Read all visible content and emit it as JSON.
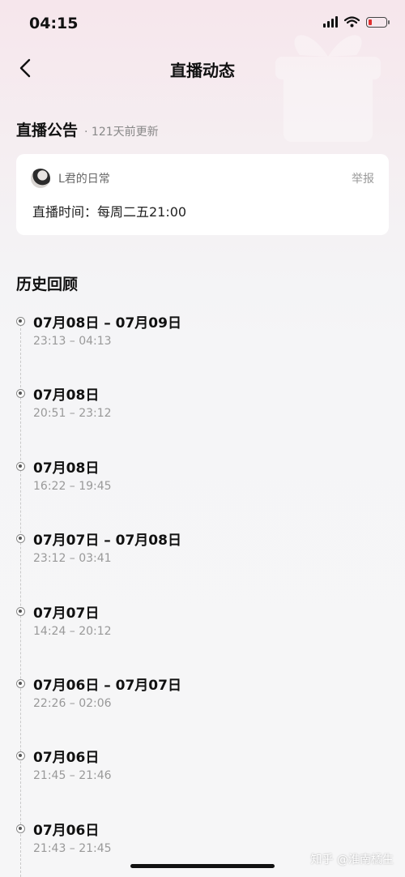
{
  "status_bar": {
    "time": "04:15",
    "icons": [
      "signal-icon",
      "wifi-icon",
      "battery-icon"
    ],
    "battery_level": 0.15,
    "battery_color": "#e0302f"
  },
  "nav": {
    "back_icon": "chevron-left-icon",
    "title": "直播动态"
  },
  "announcement": {
    "title": "直播公告",
    "updated": "· 121天前更新",
    "author": "L君的日常",
    "report_label": "举报",
    "content": "直播时间：每周二五21:00"
  },
  "history": {
    "title": "历史回顾",
    "entries": [
      {
        "date": "07月08日 – 07月09日",
        "time": "23:13 – 04:13"
      },
      {
        "date": "07月08日",
        "time": "20:51 – 23:12"
      },
      {
        "date": "07月08日",
        "time": "16:22 – 19:45"
      },
      {
        "date": "07月07日 – 07月08日",
        "time": "23:12 – 03:41"
      },
      {
        "date": "07月07日",
        "time": "14:24 – 20:12"
      },
      {
        "date": "07月06日 – 07月07日",
        "time": "22:26 – 02:06"
      },
      {
        "date": "07月06日",
        "time": "21:45 – 21:46"
      },
      {
        "date": "07月06日",
        "time": "21:43 – 21:45"
      }
    ]
  },
  "watermark": "知乎 @淮南橘生"
}
